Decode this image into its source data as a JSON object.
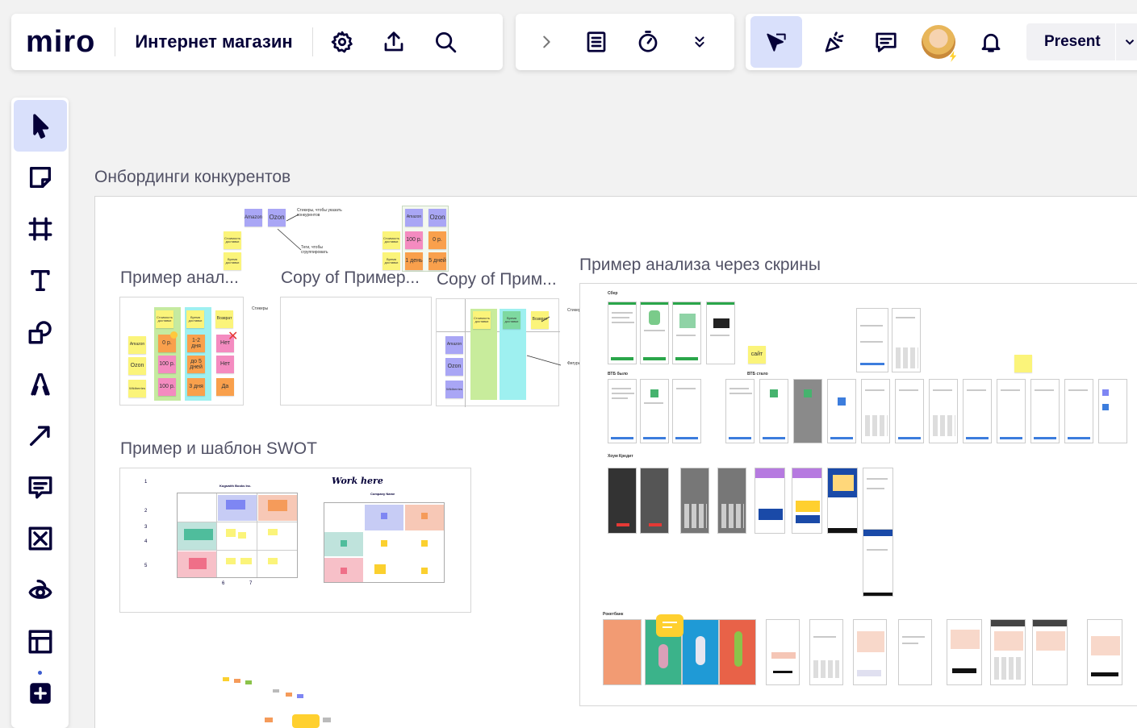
{
  "header": {
    "logo": "miro",
    "board_title": "Интернет магазин",
    "icons": [
      "gear-icon",
      "upload-icon",
      "search-icon",
      "chevron-right-icon",
      "document-icon",
      "timer-icon",
      "double-chevron-down-icon",
      "cursor-flag-icon",
      "party-popper-icon",
      "comment-icon",
      "avatar",
      "bell-icon"
    ],
    "present_label": "Present"
  },
  "left_toolbar": {
    "tools": [
      "select",
      "sticky-note",
      "frame",
      "text",
      "shapes",
      "pen",
      "arrow",
      "comment",
      "crop-mark",
      "eye",
      "templates",
      "more"
    ]
  },
  "board": {
    "main_title": "Онбординги конкурентов",
    "frames": {
      "f1_title": "Пример анал...",
      "f2_title": "Copy of Пример...",
      "f3_title": "Copy of Прим...",
      "f4_title": "Пример и шаблон SWOT",
      "f5_title": "Пример анализа через скрины"
    },
    "top_stickies": {
      "amazon": "Amazon",
      "ozon": "Ozon",
      "cost": "Стоимость доставки",
      "time": "Время доставки",
      "note1": "Стикеры, чтобы указать конкурентов",
      "note2": "Теги, чтобы сгруппировать",
      "v100": "100 р.",
      "v0": "0 р.",
      "v1": "1 день",
      "v5": "5 дней"
    },
    "f1": {
      "amazon": "Amazon",
      "ozon": "Ozon",
      "wb": "Wildberries",
      "cost": "Стоимость доставки",
      "time": "Время доставки",
      "ret": "Возврат",
      "stickers": "Стикеры",
      "c1": "0 р.",
      "c2": "100 р.",
      "c3": "100 р.",
      "t1": "1-2 дня",
      "t2": "до 5 дней",
      "t3": "3 дня",
      "r1": "Нет",
      "r2": "Нет",
      "r3": "Да"
    },
    "f3": {
      "cost": "Стоимость доставки",
      "time": "Время доставки",
      "ret": "Возврат",
      "amazon": "Amazon",
      "ozon": "Ozon",
      "wb": "Wildberries",
      "stickers": "Стикеры",
      "shapes": "Фигуры"
    },
    "swot": {
      "company": "Kogswith Books Inc.",
      "work_here": "Work here",
      "company_name": "Company Name",
      "nums": [
        "1",
        "2",
        "3",
        "4",
        "5",
        "6",
        "7"
      ]
    },
    "screens": {
      "s1": "Сбер",
      "s2": "ВТБ было",
      "s3": "ВТБ стало",
      "s4": "Хоум Кредит",
      "s5": "Рокетбанк",
      "site": "сайт"
    }
  }
}
